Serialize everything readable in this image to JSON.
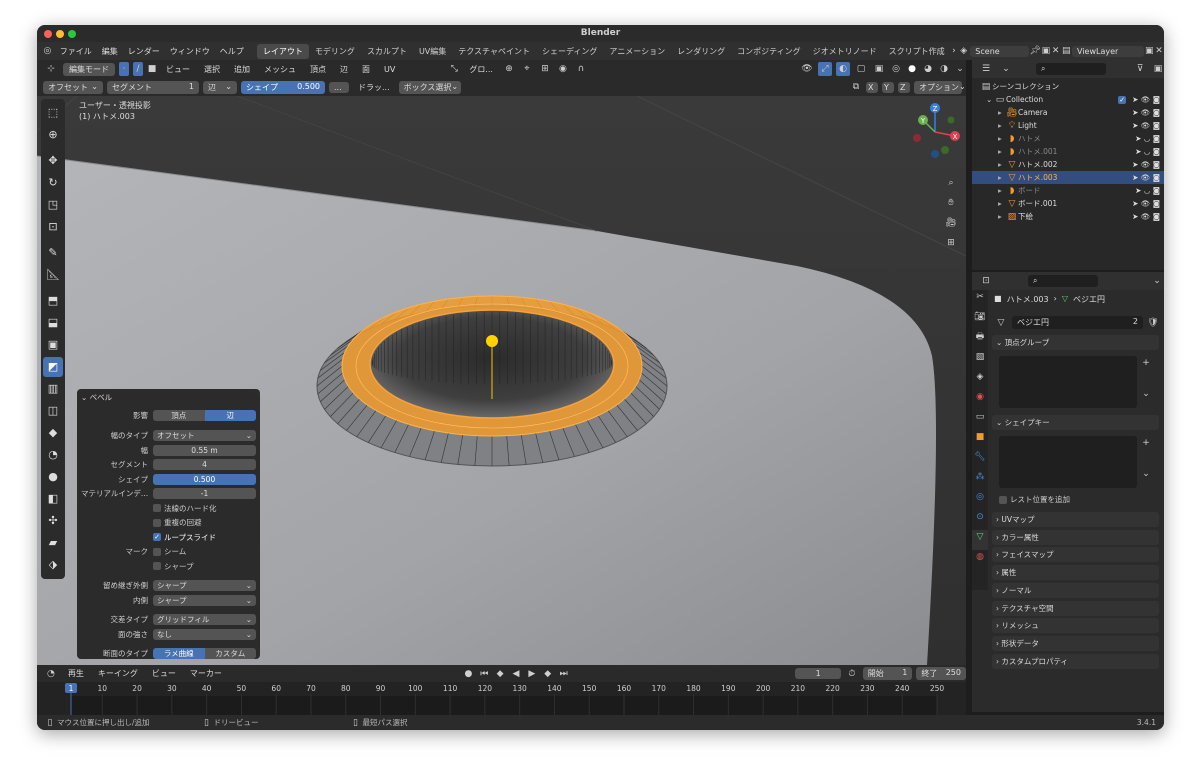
{
  "window": {
    "title": "Blender"
  },
  "menu": {
    "items": [
      "ファイル",
      "編集",
      "レンダー",
      "ウィンドウ",
      "ヘルプ"
    ],
    "workspaces": [
      "レイアウト",
      "モデリング",
      "スカルプト",
      "UV編集",
      "テクスチャペイント",
      "シェーディング",
      "アニメーション",
      "レンダリング",
      "コンポジティング",
      "ジオメトリノード",
      "スクリプト作成"
    ],
    "scene": "Scene",
    "view_layer": "ViewLayer"
  },
  "header": {
    "mode": "編集モード",
    "menus": [
      "ビュー",
      "選択",
      "追加",
      "メッシュ",
      "頂点",
      "辺",
      "面",
      "UV"
    ],
    "transform": "グロ...",
    "options": "オプション"
  },
  "tool_header": {
    "offset": "オフセット",
    "segment_label": "セグメント",
    "segment_value": "1",
    "edge": "辺",
    "shape_label": "シェイプ",
    "shape_value": "0.500",
    "drag": "ドラッ...",
    "box_select": "ボックス選択",
    "axes": [
      "X",
      "Y",
      "Z"
    ]
  },
  "viewport": {
    "view_name": "ユーザー・透視投影",
    "object_name": "(1) ハトメ.003"
  },
  "bevel": {
    "title": "ベベル",
    "affect_label": "影響",
    "affect_vertex": "頂点",
    "affect_edge": "辺",
    "width_type_label": "幅のタイプ",
    "width_type": "オフセット",
    "width_label": "幅",
    "width": "0.55 m",
    "segments_label": "セグメント",
    "segments": "4",
    "shape_label": "シェイプ",
    "shape": "0.500",
    "material_label": "マテリアルインデ...",
    "material": "-1",
    "harden_normals": "法線のハード化",
    "clamp_overlap": "重複の回避",
    "loop_slide": "ループスライド",
    "mark_label": "マーク",
    "seam": "シーム",
    "sharp": "シャープ",
    "miter_outer_label": "留め継ぎ外側",
    "miter_outer": "シャープ",
    "inner_label": "内側",
    "inner": "シャープ",
    "intersection_label": "交差タイプ",
    "intersection": "グリッドフィル",
    "face_strength_label": "面の強さ",
    "face_strength": "なし",
    "profile_label": "断面のタイプ",
    "profile_superellipse": "ラメ曲線",
    "profile_custom": "カスタム"
  },
  "outliner": {
    "root": "シーンコレクション",
    "collection": "Collection",
    "items": [
      {
        "name": "Camera",
        "dim": false,
        "sel": false
      },
      {
        "name": "Light",
        "dim": false,
        "sel": false
      },
      {
        "name": "ハトメ",
        "dim": true,
        "sel": false
      },
      {
        "name": "ハトメ.001",
        "dim": true,
        "sel": false
      },
      {
        "name": "ハトメ.002",
        "dim": false,
        "sel": false
      },
      {
        "name": "ハトメ.003",
        "dim": false,
        "sel": true
      },
      {
        "name": "ボード",
        "dim": true,
        "sel": false
      },
      {
        "name": "ボード.001",
        "dim": false,
        "sel": false
      },
      {
        "name": "下絵",
        "dim": false,
        "sel": false
      }
    ]
  },
  "properties": {
    "object": "ハトメ.003",
    "data": "ベジエ円",
    "data_name": "ベジエ円",
    "users": "2",
    "vertex_groups": "頂点グループ",
    "shape_keys": "シェイプキー",
    "relative": "レスト位置を追加",
    "sections": [
      "UVマップ",
      "カラー属性",
      "フェイスマップ",
      "属性",
      "ノーマル",
      "テクスチャ空間",
      "リメッシュ",
      "形状データ",
      "カスタムプロパティ"
    ]
  },
  "timeline": {
    "playback": "再生",
    "keying": "キーイング",
    "view": "ビュー",
    "marker": "マーカー",
    "current_frame": "1",
    "start_label": "開始",
    "start": "1",
    "end_label": "終了",
    "end": "250",
    "ticks": [
      "1",
      "10",
      "20",
      "30",
      "40",
      "50",
      "60",
      "70",
      "80",
      "90",
      "100",
      "110",
      "120",
      "130",
      "140",
      "150",
      "160",
      "170",
      "180",
      "190",
      "200",
      "210",
      "220",
      "230",
      "240",
      "250"
    ]
  },
  "status": {
    "left": "マウス位置に押し出し/追加",
    "middle": "ドリービュー",
    "right": "最短パス選択",
    "version": "3.4.1"
  },
  "colors": {
    "accent": "#4772b3",
    "selection": "#ff9a1f",
    "background": "#1d1d1d"
  }
}
